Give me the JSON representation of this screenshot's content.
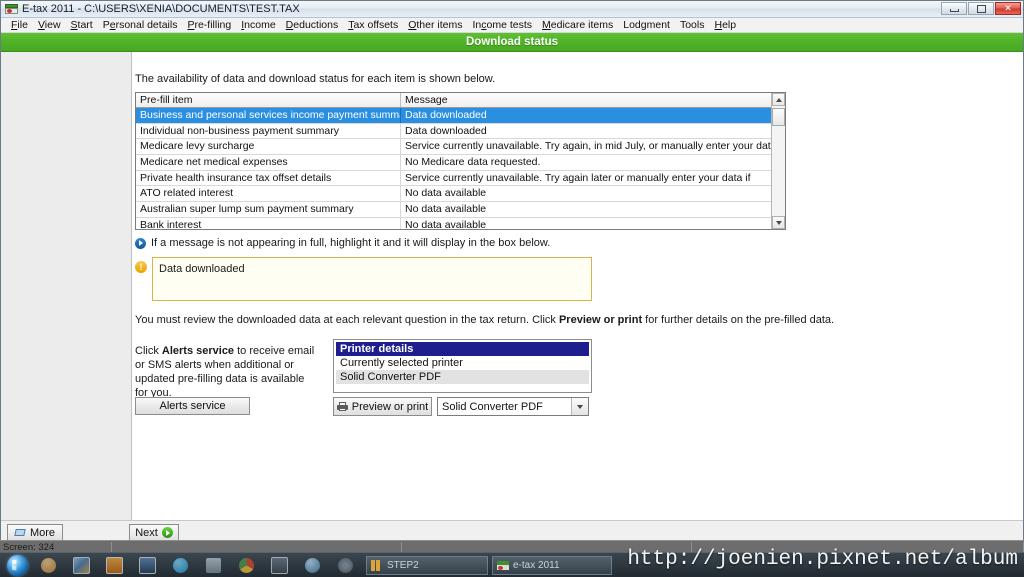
{
  "window": {
    "title": "E-tax 2011 - C:\\USERS\\XENIA\\DOCUMENTS\\TEST.TAX",
    "app_icon": "etax-icon",
    "controls": {
      "minimize": "minimize-icon",
      "maximize": "maximize-icon",
      "close": "✕"
    }
  },
  "menu": {
    "items": [
      {
        "label": "File"
      },
      {
        "label": "View"
      },
      {
        "label": "Start"
      },
      {
        "label": "Personal details"
      },
      {
        "label": "Pre-filling"
      },
      {
        "label": "Income"
      },
      {
        "label": "Deductions"
      },
      {
        "label": "Tax offsets"
      },
      {
        "label": "Other items"
      },
      {
        "label": "Income tests"
      },
      {
        "label": "Medicare items"
      },
      {
        "label": "Lodgment"
      },
      {
        "label": "Tools"
      },
      {
        "label": "Help"
      }
    ]
  },
  "page": {
    "header_title": "Download status",
    "intro": "The availability of data and download status for each item is shown below.",
    "hint": "If a message is not appearing in full, highlight it and it will display in the box below.",
    "message_box_text": "Data downloaded",
    "review_prefix": "You must review the downloaded data at each relevant question in the tax return. Click ",
    "review_bold": "Preview or print",
    "review_suffix": " for further details on the pre-filled data."
  },
  "table": {
    "columns": [
      "Pre-fill item",
      "Message"
    ],
    "rows": [
      {
        "item": "Business and personal services income payment summary",
        "message": "Data downloaded",
        "selected": true
      },
      {
        "item": "Individual non-business payment summary",
        "message": "Data downloaded",
        "selected": false
      },
      {
        "item": "Medicare levy surcharge",
        "message": "Service currently unavailable. Try again, in mid July, or manually enter your data if",
        "selected": false
      },
      {
        "item": "Medicare net medical expenses",
        "message": "No Medicare data requested.",
        "selected": false
      },
      {
        "item": "Private health insurance tax offset details",
        "message": "Service currently unavailable. Try again later or manually enter your data if",
        "selected": false
      },
      {
        "item": "ATO related interest",
        "message": "No data available",
        "selected": false
      },
      {
        "item": "Australian super lump sum payment summary",
        "message": "No data available",
        "selected": false
      },
      {
        "item": "Bank interest",
        "message": "No data available",
        "selected": false
      }
    ]
  },
  "alerts": {
    "text_prefix": "Click ",
    "text_bold": "Alerts service",
    "text_suffix": " to receive email or SMS alerts when additional or updated pre-filling data is available for you.",
    "button_label": "Alerts service"
  },
  "printer": {
    "panel_title": "Printer details",
    "subtitle": "Currently selected printer",
    "name": "Solid Converter PDF",
    "preview_button": "Preview or print",
    "select_value": "Solid Converter PDF"
  },
  "nav": {
    "more_label": "More",
    "next_label": "Next"
  },
  "status": {
    "screen": "Screen: 324",
    "panel2": "",
    "panel3": "",
    "panel4": ""
  },
  "taskbar": {
    "start": "start-orb-icon",
    "icons": [
      {
        "name": "user-account-icon",
        "color": "#d2a05a"
      },
      {
        "name": "photo-gallery-icon",
        "color": "#6f9ed8"
      },
      {
        "name": "media-player-icon",
        "color": "#e08a22"
      },
      {
        "name": "app-blue-icon",
        "color": "#2e5d8d"
      },
      {
        "name": "skype-icon",
        "color": "#26a5e0"
      },
      {
        "name": "dictionary-icon",
        "color": "#8fa6b5"
      },
      {
        "name": "chrome-icon",
        "color": "#d8472b"
      },
      {
        "name": "office-icon",
        "color": "#4a5a6a"
      },
      {
        "name": "internet-explorer-icon",
        "color": "#4f8fc0"
      },
      {
        "name": "disc-icon",
        "color": "#5a6a76"
      }
    ],
    "tasks": [
      {
        "label": "STEP2",
        "name": "taskbar-task-step2"
      },
      {
        "label": "e-tax 2011",
        "name": "taskbar-task-etax"
      }
    ]
  },
  "watermark": {
    "url": "http://joenien.pixnet.net/album"
  },
  "colors": {
    "header_green": "#4fb227",
    "selection_blue": "#2a8fe0",
    "printer_title_blue": "#1e1e8f",
    "warn_box_border": "#d8b34e",
    "warn_box_bg": "#fffef2"
  }
}
